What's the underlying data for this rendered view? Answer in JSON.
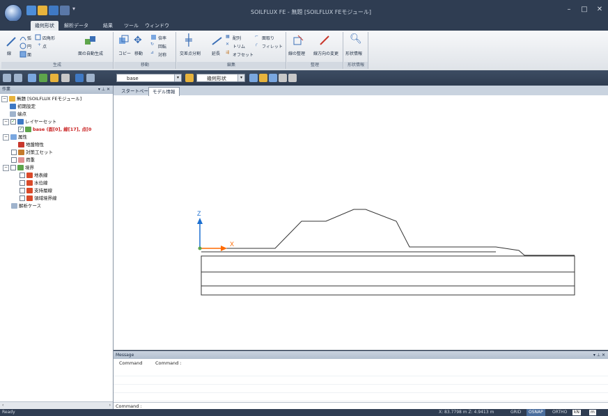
{
  "window": {
    "title": "SOILFLUX FE - 無題 [SOILFLUX FEモジュール]",
    "controls": [
      "–",
      "□",
      "✕"
    ]
  },
  "ribbon": {
    "tabs": [
      "幾何形状",
      "解析データ",
      "結果",
      "ツール",
      "ウィンドウ"
    ],
    "active_tab": "幾何形状",
    "groups": [
      {
        "label": "生成",
        "tools": [
          "線",
          "弧",
          "四角形",
          "円",
          "点",
          "面",
          "面の自動生成"
        ]
      },
      {
        "label": "移動",
        "tools": [
          "コピー",
          "移動",
          "倍率",
          "回転",
          "対称"
        ]
      },
      {
        "label": "編集",
        "tools": [
          "交差点分割",
          "延長",
          "配列",
          "トリム",
          "オフセット",
          "面取り",
          "フィレット"
        ]
      },
      {
        "label": "整理",
        "tools": [
          "線の整理",
          "線方向の変更"
        ]
      },
      {
        "label": "形状情報",
        "tools": [
          "形状情報"
        ]
      }
    ]
  },
  "toolbar": {
    "layer_combo": "base",
    "mode_combo": "幾何形状"
  },
  "tree": {
    "header": "作業",
    "root": "無題 [SOILFLUX FEモジュール]",
    "items": [
      {
        "label": "初期設定",
        "indent": 1
      },
      {
        "label": "端点",
        "indent": 1
      },
      {
        "label": "レイヤーセット",
        "indent": 1
      },
      {
        "label": "base (面[0], 線[17], 点[0",
        "indent": 2,
        "highlight": true
      },
      {
        "label": "属性",
        "indent": 1
      },
      {
        "label": "地盤物性",
        "indent": 2
      },
      {
        "label": "対策工セット",
        "indent": 2
      },
      {
        "label": "荷重",
        "indent": 2
      },
      {
        "label": "境界",
        "indent": 2
      },
      {
        "label": "地表線",
        "indent": 3
      },
      {
        "label": "水位線",
        "indent": 3
      },
      {
        "label": "支持層線",
        "indent": 3
      },
      {
        "label": "領域境界線",
        "indent": 3
      },
      {
        "label": "解析ケース",
        "indent": 1
      }
    ]
  },
  "doc_tabs": [
    "スタートページ",
    "モデル情報"
  ],
  "axes": {
    "z": "Z",
    "x": "X"
  },
  "messages": {
    "header": "Message",
    "col1": "Command",
    "col2": "Command :",
    "command_prompt": "Command :"
  },
  "status": {
    "ready": "Ready",
    "coords": "X: 83.7798 m  Z: 4.9413 m",
    "grid": "GRID",
    "osnap": "OSNAP",
    "ortho": "ORTHO",
    "unit_force": "kN",
    "unit_length": "m"
  },
  "colors": {
    "chrome": "#2f3d52",
    "ribbon": "#e9ecef",
    "x_axis": "#ff6a00",
    "z_axis": "#1c6fd0",
    "highlight_text": "#c81c1c"
  }
}
